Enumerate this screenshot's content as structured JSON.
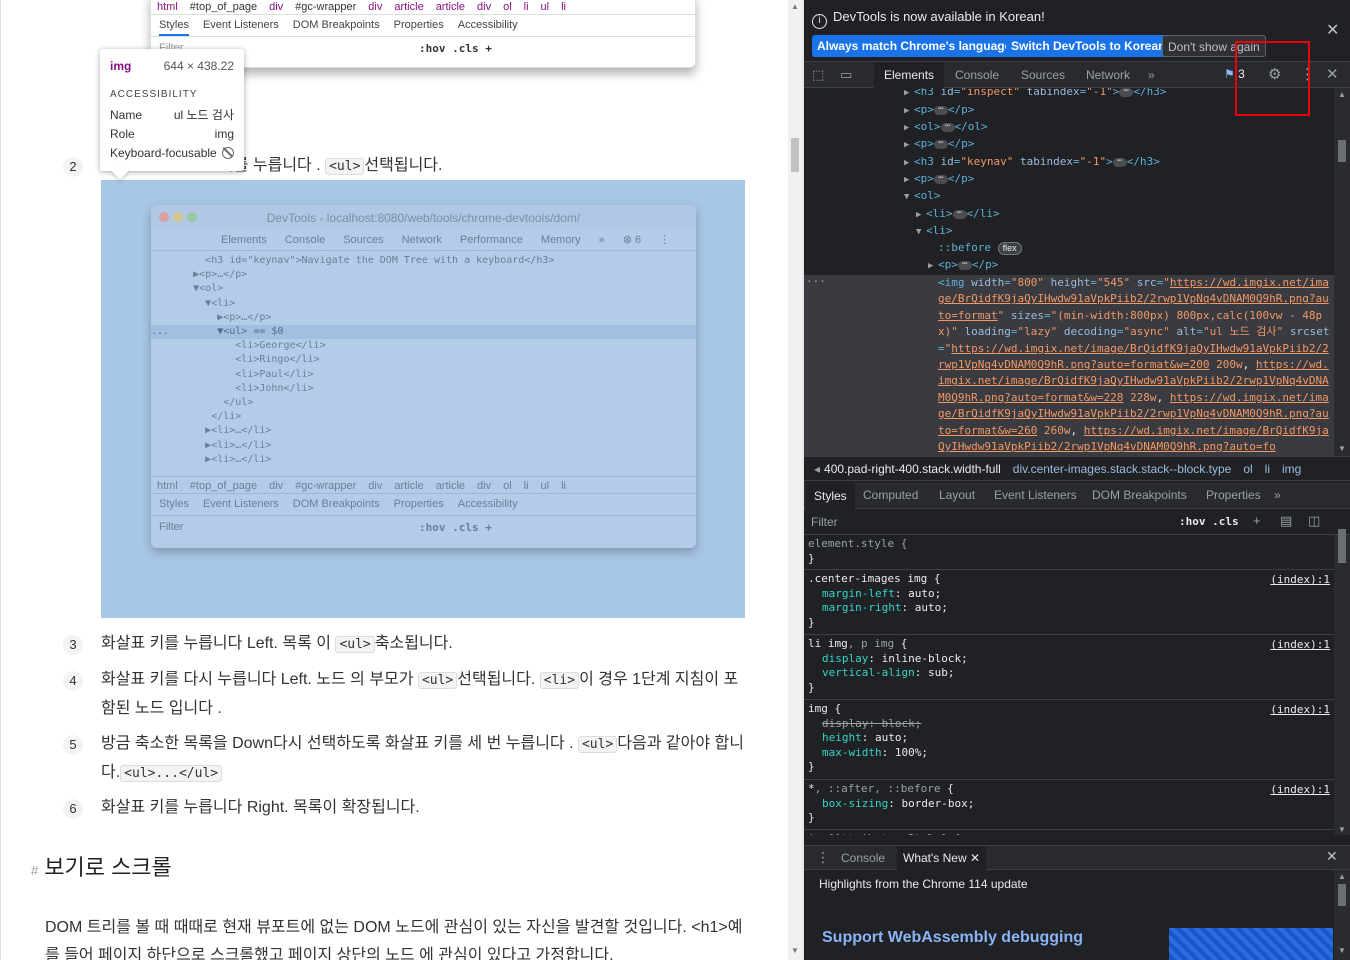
{
  "page": {
    "shot_top": {
      "breadcrumbs": [
        "html",
        "#top_of_page",
        "div",
        "#gc-wrapper",
        "div",
        "article",
        "article",
        "div",
        "ol",
        "li",
        "ul",
        "li"
      ],
      "style_tabs": [
        "Styles",
        "Event Listeners",
        "DOM Breakpoints",
        "Properties",
        "Accessibility"
      ],
      "filter_placeholder": "Filter",
      "hov_cls": ":hov  .cls  +"
    },
    "tooltip": {
      "tag": "img",
      "dims": "644 × 438.22",
      "section": "ACCESSIBILITY",
      "name_label": "Name",
      "name_value": "ul 노드 검사",
      "role_label": "Role",
      "role_value": "img",
      "focus_label": "Keyboard-focusable"
    },
    "step2": {
      "num": "2",
      "text_a": "키를 누릅니다 .",
      "code": "<ul>",
      "text_b": "선택됩니다."
    },
    "inner_shot": {
      "title": "DevTools - localhost:8080/web/tools/chrome-devtools/dom/",
      "tabs": [
        "Elements",
        "Console",
        "Sources",
        "Network",
        "Performance",
        "Memory",
        "»",
        "⊗ 6",
        "⋮"
      ],
      "code_lines": [
        "         <h3 id=\"keynav\">Navigate the DOM Tree with a keyboard</h3>",
        "       ▶<p>…</p>",
        "       ▼<ol>",
        "         ▼<li>",
        "           ▶<p>…</p>",
        "...        ▼<ul> == $0",
        "              <li>George</li>",
        "              <li>Ringo</li>",
        "              <li>Paul</li>",
        "              <li>John</li>",
        "            </ul>",
        "          </li>",
        "         ▶<li>…</li>",
        "         ▶<li>…</li>",
        "         ▶<li>…</li>"
      ],
      "breadcrumbs": [
        "html",
        "#top_of_page",
        "div",
        "#gc-wrapper",
        "div",
        "article",
        "article",
        "div",
        "ol",
        "li",
        "ul",
        "li"
      ],
      "style_tabs": [
        "Styles",
        "Event Listeners",
        "DOM Breakpoints",
        "Properties",
        "Accessibility"
      ],
      "filter": "Filter",
      "hov_cls": ":hov  .cls  +"
    },
    "steps": [
      {
        "num": "3",
        "html": "화살표 키를 누릅니다 Left. 목록 이 <code class=\"c\">&lt;ul&gt;</code>축소됩니다."
      },
      {
        "num": "4",
        "html": "화살표 키를 다시 누릅니다 Left. 노드 의 부모가 <code class=\"c\">&lt;ul&gt;</code>선택됩니다. <code class=\"c\">&lt;li&gt;</code>이 경우 1단계 지침이 포함된 노드 입니다 ."
      },
      {
        "num": "5",
        "html": "방금 축소한 목록을 Down다시 선택하도록 화살표 키를 세 번 누릅니다 . <code class=\"c\">&lt;ul&gt;</code>다음과 같아야 합니다.<code class=\"c\">&lt;ul&gt;...&lt;/ul&gt;</code>"
      },
      {
        "num": "6",
        "html": "화살표 키를 누릅니다 Right. 목록이 확장됩니다."
      }
    ],
    "section": {
      "hash": "#",
      "title": "보기로 스크롤"
    },
    "para": "DOM 트리를 볼 때 때때로 현재 뷰포트에 없는 DOM 노드에 관심이 있는 자신을 발견할 것입니다. <h1>예를 들어 페이지 하단으로 스크롤했고 페이지 상단의 노드 에 관심이 있다고 가정합니다."
  },
  "devtools": {
    "info_msg": "DevTools is now available in Korean!",
    "btn_match": "Always match Chrome's language",
    "btn_switch": "Switch DevTools to Korean",
    "btn_dont": "Don't show again",
    "tabs": [
      "Elements",
      "Console",
      "Sources",
      "Network",
      "»"
    ],
    "issues_count": "3",
    "breadcrumb": [
      "400.pad-right-400.stack.width-full",
      "div.center-images.stack.stack--block.type",
      "ol",
      "li",
      "img"
    ],
    "style_tabs": [
      "Styles",
      "Computed",
      "Layout",
      "Event Listeners",
      "DOM Breakpoints",
      "Properties",
      "»"
    ],
    "filter": "Filter",
    "hov_cls": ":hov .cls",
    "drawer_tabs": [
      "Console",
      "What's New"
    ],
    "whats_new": "Highlights from the Chrome 114 update",
    "wasm": "Support WebAssembly debugging",
    "img_src_text": "https://wd.imgix.net/image/BrQidfK9jaQyIHwdw91aVpkPiib2/2rwp1VpNq4vDNAM0Q9hR.png?auto=format",
    "srcset_1": "https://wd.imgix.net/image/BrQidfK9jaQyIHwdw91aVpkPiib2/2rwp1VpNq4vDNAM0Q9hR.png?auto=format&w=200",
    "srcset_2": "https://wd.imgix.net/image/BrQidfK9jaQyIHwdw91aVpkPiib2/2rwp1VpNq4vDNAM0Q9hR.png?auto=format&w=228",
    "srcset_3": "https://wd.imgix.net/image/BrQidfK9jaQyIHwdw91aVpkPiib2/2rwp1VpNq4vDNAM0Q9hR.png?auto=format&w=260",
    "srcset_4": "https://wd.imgix.net/image/BrQidfK9jaQyIHwdw91aVpkPiib2/2rwp1VpNq4vDNAM0Q9hR.png?auto=fo",
    "alt": "ul 노드 검사",
    "rule_src": "(index):1"
  }
}
